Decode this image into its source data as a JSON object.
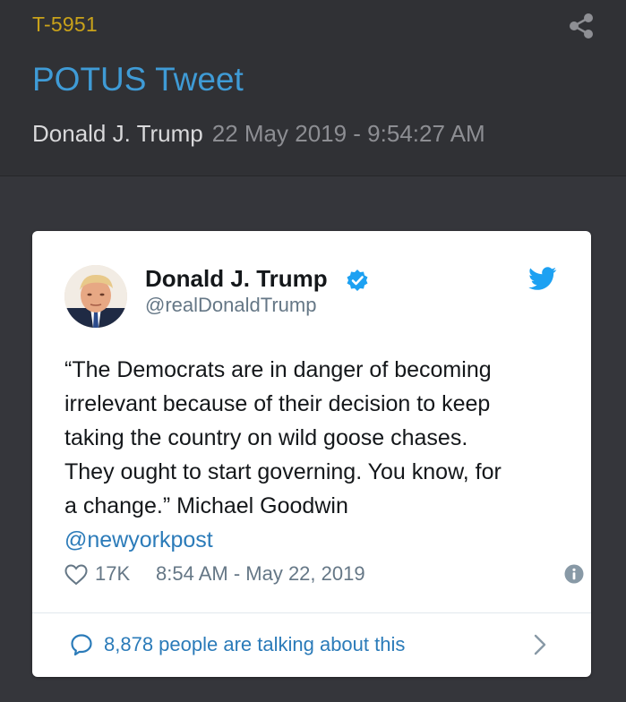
{
  "header": {
    "ticket_id": "T-5951",
    "title": "POTUS Tweet",
    "author": "Donald J. Trump",
    "timestamp": "22 May 2019 - 9:54:27 AM"
  },
  "colors": {
    "ticket_id": "#c9a21a",
    "title": "#3f9bd6",
    "background": "#35363b",
    "twitter_blue": "#1da1f2",
    "link": "#2b7bb9"
  },
  "tweet": {
    "display_name": "Donald J. Trump",
    "handle": "@realDonaldTrump",
    "verified": true,
    "text_lines": [
      "“The Democrats are in danger of becoming",
      "irrelevant because of their decision to keep",
      "taking the country on wild goose chases.",
      "They ought to start governing. You know, for",
      "a change.”  Michael Goodwin"
    ],
    "mention": "@newyorkpost",
    "likes": "17K",
    "time": "8:54 AM - May 22, 2019",
    "talking_about": "8,878 people are talking about this"
  },
  "icons": {
    "share": "share-icon",
    "verified": "verified-badge-icon",
    "bird": "twitter-bird-icon",
    "heart": "heart-icon",
    "info": "info-icon",
    "bubble": "speech-bubble-icon",
    "chevron": "chevron-right-icon"
  }
}
